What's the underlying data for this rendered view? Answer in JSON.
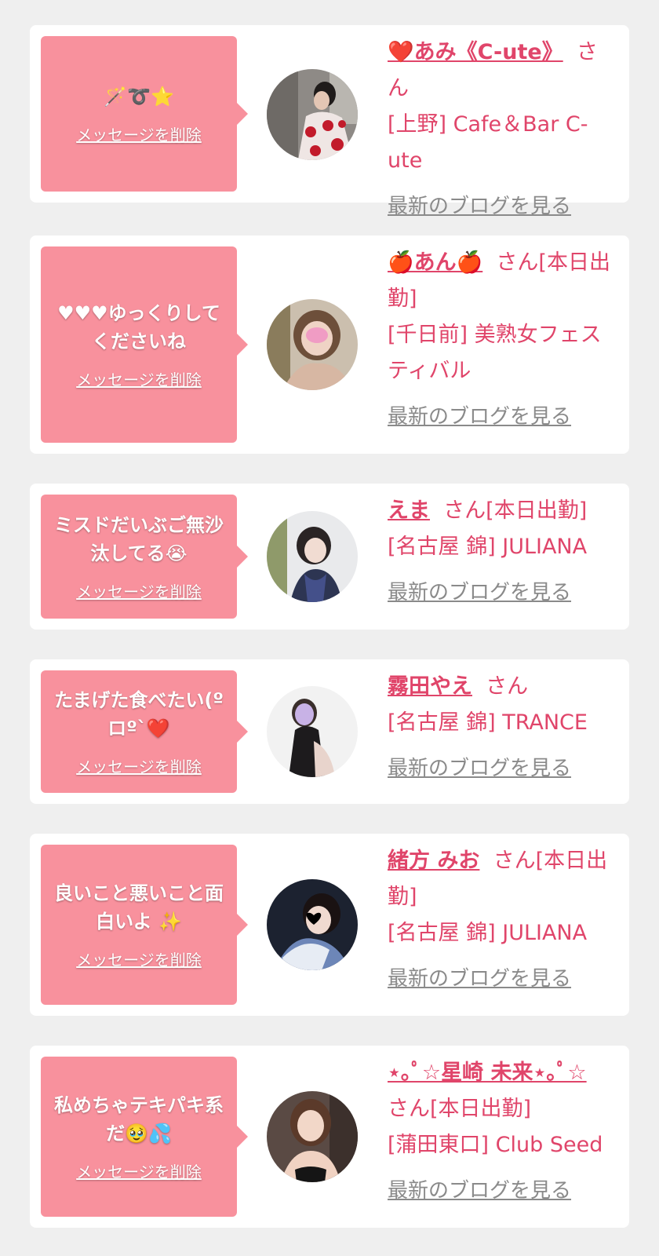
{
  "delete_label": "メッセージを削除",
  "blog_label": "最新のブログを見る",
  "cards": [
    {
      "message": "🪄➰⭐",
      "name": "❤️あみ《C-ute》",
      "san": "さん",
      "shop": "[上野] Cafe＆Bar C-ute"
    },
    {
      "message": "♥♥♥ゆっくりしてくださいね",
      "name": "🍎あん🍎",
      "san": "さん[本日出勤]",
      "shop": "[千日前] 美熟女フェスティバル"
    },
    {
      "message": "ミスドだいぶご無沙汰してる😭",
      "name": "えま",
      "san": "さん[本日出勤]",
      "shop": "[名古屋 錦] JULIANA"
    },
    {
      "message": "たまげた食べたい(ºロº`❤️",
      "name": "霧田やえ",
      "san": "さん",
      "shop": "[名古屋 錦] TRANCE"
    },
    {
      "message": "良いこと悪いこと面白いよ ✨",
      "name": "緒方 みお",
      "san": "さん[本日出勤]",
      "shop": "[名古屋 錦] JULIANA"
    },
    {
      "message": "私めちゃテキパキ系だ🥹💦",
      "name": "⋆｡ﾟ☆星崎 未来⋆｡ﾟ☆",
      "san": "さん[本日出勤]",
      "shop": "[蒲田東口] Club Seed"
    }
  ]
}
